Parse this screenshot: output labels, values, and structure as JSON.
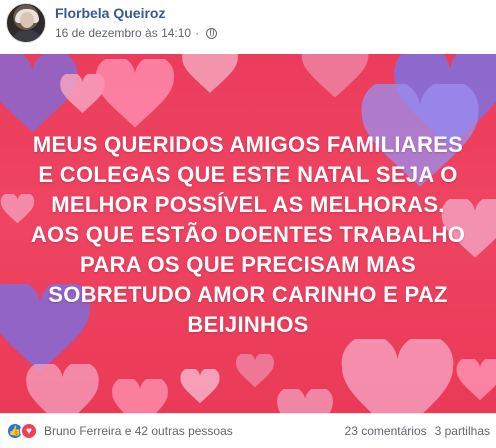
{
  "author": {
    "name": "Florbela Queiroz"
  },
  "post_meta": {
    "date": "16 de dezembro às 14:10",
    "privacy_icon": "globe-icon"
  },
  "post": {
    "text": "MEUS QUERIDOS AMIGOS FAMILIARES E COLEGAS QUE ESTE NATAL SEJA O MELHOR POSSÍVEL AS MELHORAS. AOS QUE ESTÃO DOENTES TRABALHO PARA OS QUE PRECISAM MAS SOBRETUDO AMOR CARINHO E PAZ BEIJINHOS",
    "background_color": "#ec3c5b"
  },
  "stats": {
    "reaction_icons": [
      "like-icon",
      "love-icon"
    ],
    "reactions_text": "Bruno Ferreira e 42 outras pessoas",
    "comments": "23 comentários",
    "shares": "3 partilhas"
  },
  "colors": {
    "name": "#385898",
    "meta": "#616770",
    "like": "#1877f2",
    "love": "#f33e58"
  }
}
